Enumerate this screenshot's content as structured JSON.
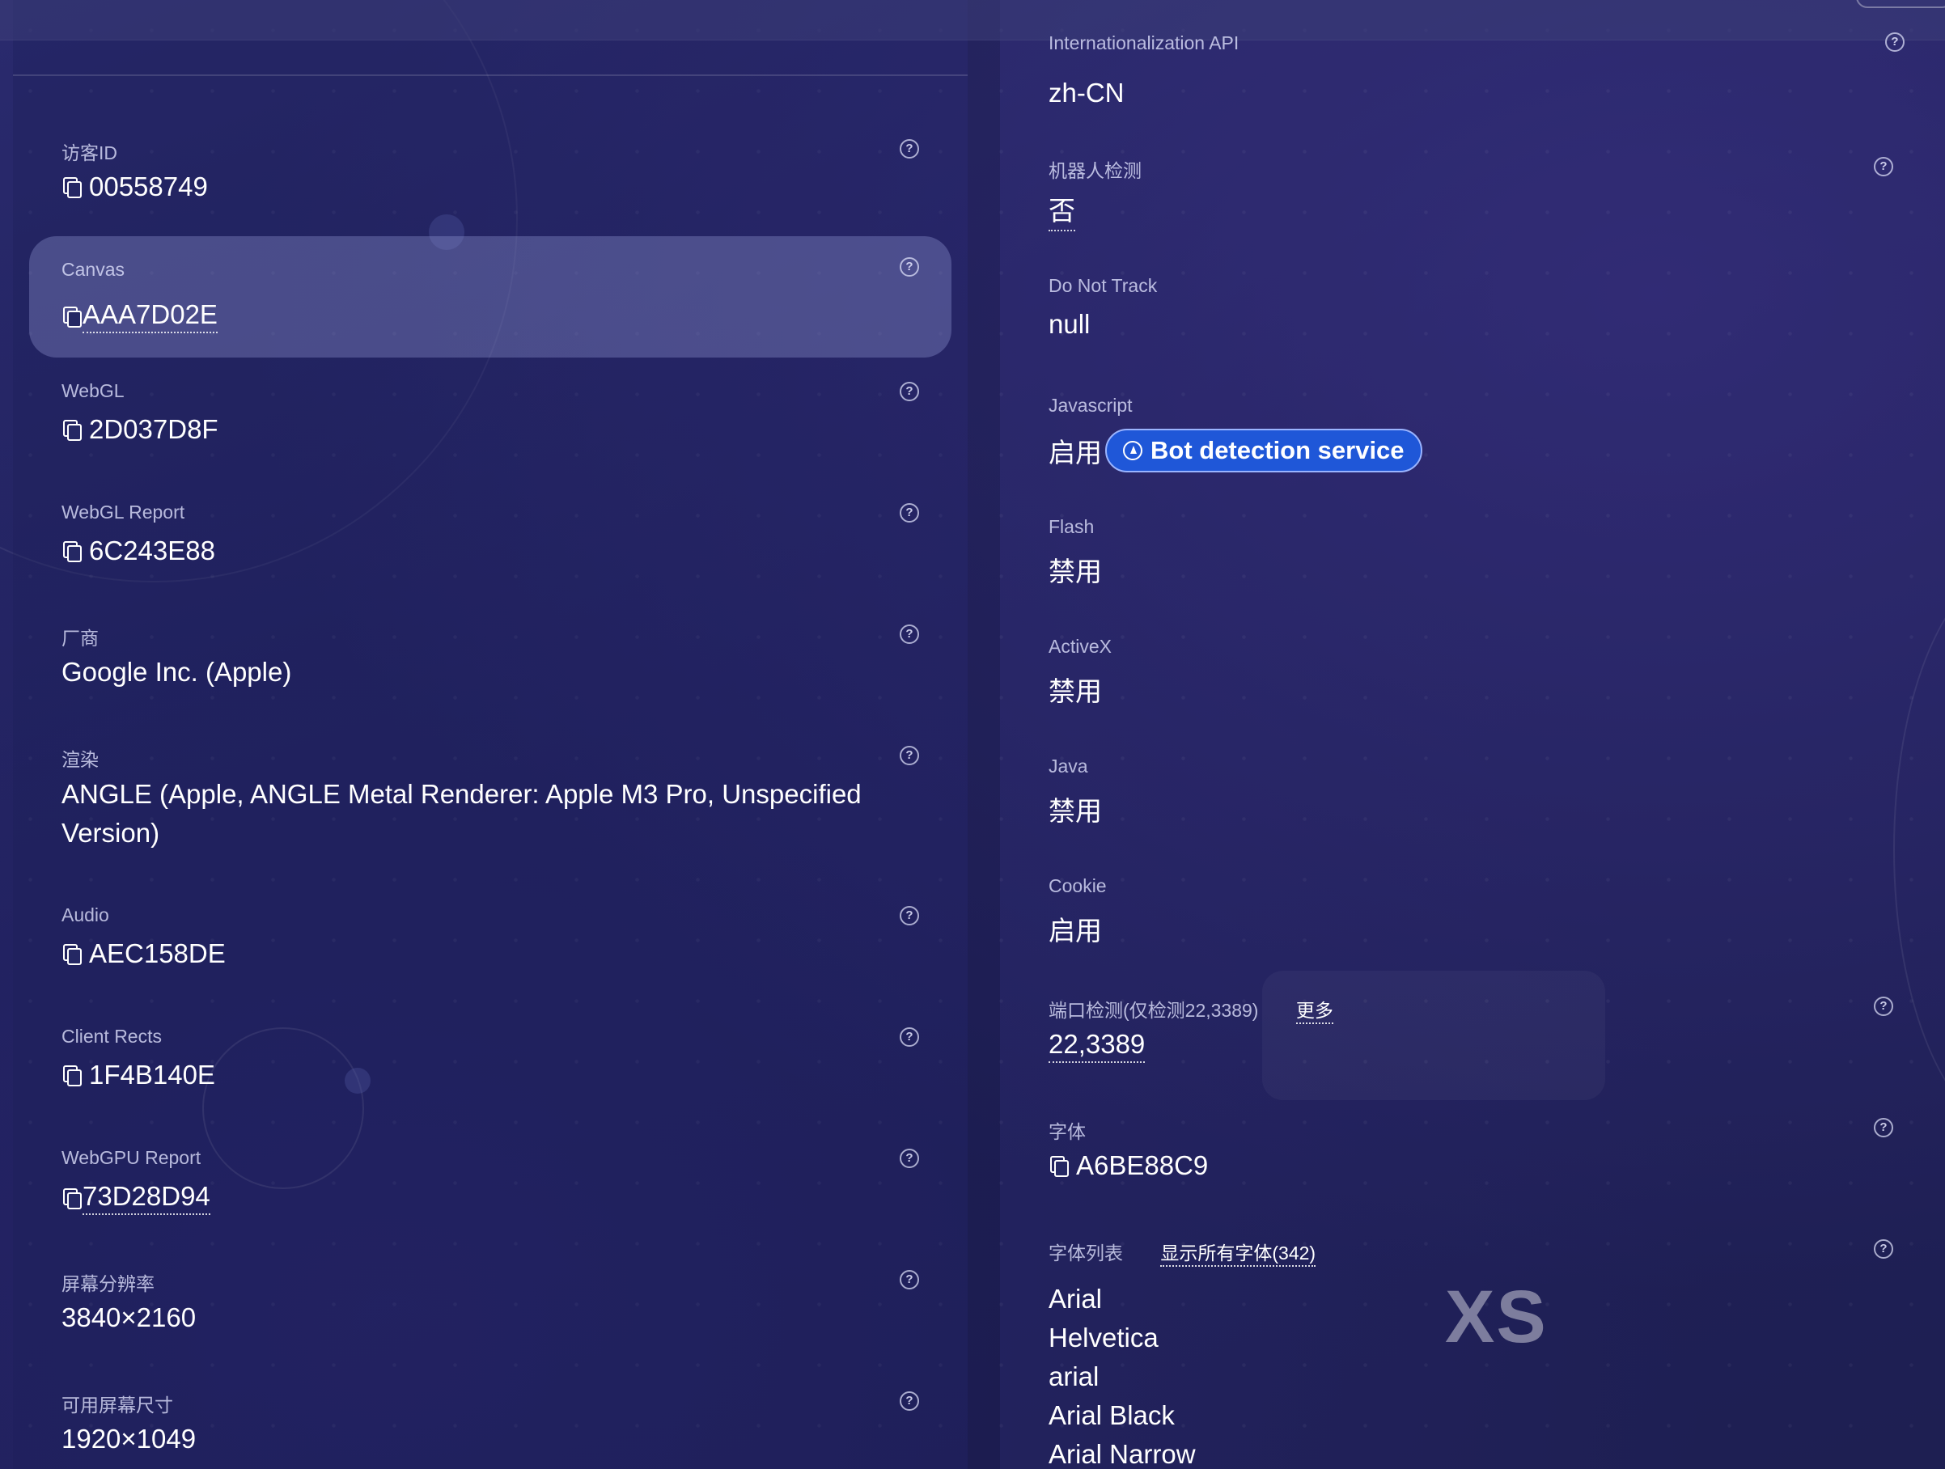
{
  "right_top": {
    "label": "Internationalization API",
    "value": "zh-CN"
  },
  "left_items": [
    {
      "label": "访客ID",
      "value": "00558749"
    },
    {
      "label": "Canvas",
      "value": "AAA7D02E"
    },
    {
      "label": "WebGL",
      "value": "2D037D8F"
    },
    {
      "label": "WebGL Report",
      "value": "6C243E88"
    },
    {
      "label": "厂商",
      "value": "Google Inc. (Apple)"
    },
    {
      "label": "渲染",
      "value": "ANGLE (Apple, ANGLE Metal Renderer: Apple M3 Pro, Unspecified Version)"
    },
    {
      "label": "Audio",
      "value": "AEC158DE"
    },
    {
      "label": "Client Rects",
      "value": "1F4B140E"
    },
    {
      "label": "WebGPU Report",
      "value": "73D28D94"
    },
    {
      "label": "屏幕分辨率",
      "value": "3840×2160"
    },
    {
      "label": "可用屏幕尺寸",
      "value": "1920×1049"
    }
  ],
  "right_items": [
    {
      "label": "机器人检测",
      "value": "否"
    },
    {
      "label": "Do Not Track",
      "value": "null"
    },
    {
      "label": "Javascript",
      "value": "启用",
      "badge": "Bot detection service"
    },
    {
      "label": "Flash",
      "value": "禁用"
    },
    {
      "label": "ActiveX",
      "value": "禁用"
    },
    {
      "label": "Java",
      "value": "禁用"
    },
    {
      "label": "Cookie",
      "value": "启用"
    },
    {
      "label": "端口检测(仅检测22,3389)",
      "link": "更多",
      "value": "22,3389"
    },
    {
      "label": "字体",
      "value": "A6BE88C9"
    },
    {
      "label": "字体列表",
      "link": "显示所有字体(342)"
    }
  ],
  "font_list": [
    "Arial",
    "Helvetica",
    "arial",
    "Arial Black",
    "Arial Narrow"
  ],
  "help_glyph": "?",
  "watermark": "XS",
  "colors": {
    "badge_bg": "#1f57d8",
    "background": "#1e2058",
    "highlight": "#8e93cf"
  }
}
